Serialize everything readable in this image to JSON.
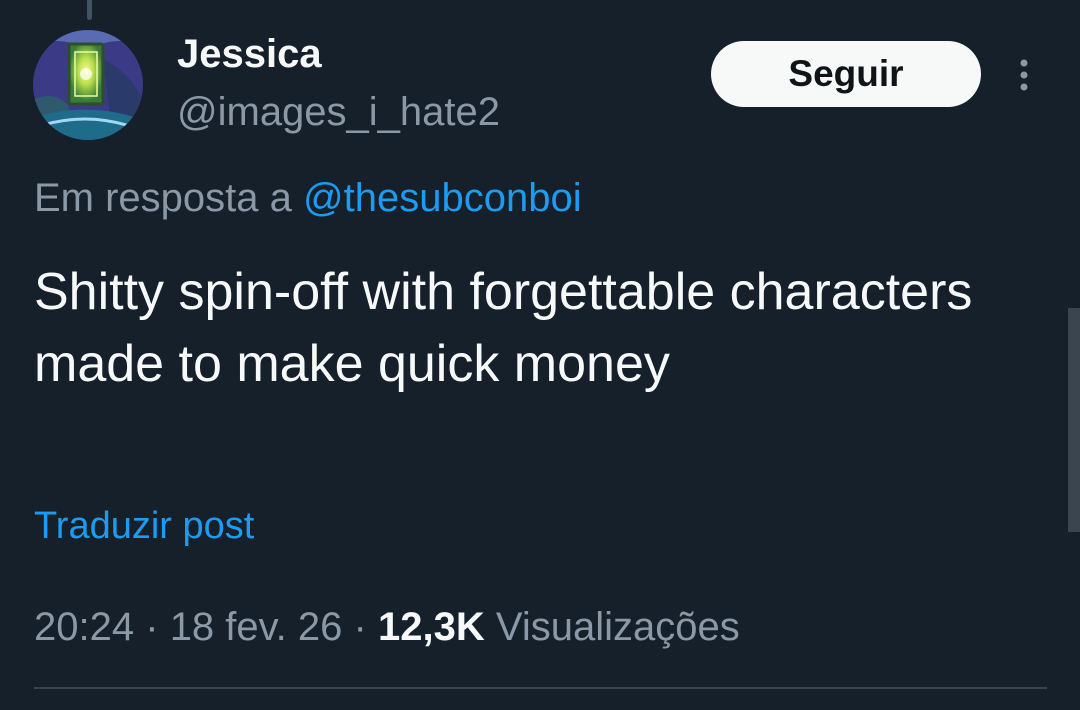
{
  "tweet": {
    "author": {
      "name": "Jessica",
      "handle": "@images_i_hate2"
    },
    "follow_label": "Seguir",
    "reply_prefix": "Em resposta a",
    "reply_mention": "@thesubconboi",
    "text": "Shitty spin-off with forgettable characters made to make quick money",
    "translate_label": "Traduzir post",
    "time": "20:24",
    "date": "18 fev. 26",
    "separator": "·",
    "views_count": "12,3K",
    "views_label": "Visualizações"
  },
  "icons": {
    "more": "more-vertical-icon"
  },
  "colors": {
    "background": "#15202b",
    "primary_text": "#f7f9f9",
    "secondary_text": "#8b98a5",
    "link": "#1d9bf0",
    "button_bg": "#f7f9f9",
    "button_text": "#0f1419"
  }
}
